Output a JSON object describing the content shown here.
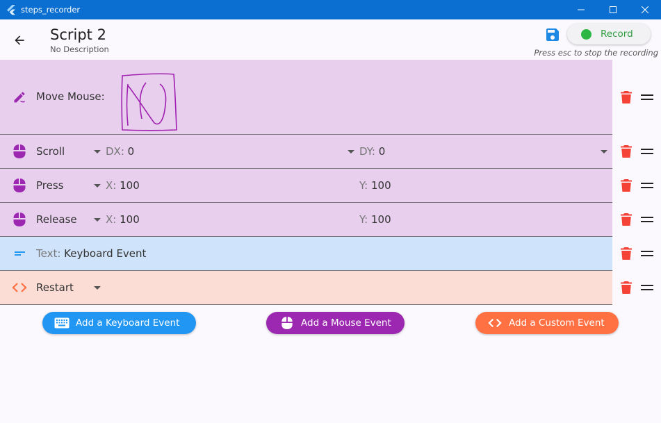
{
  "window": {
    "title": "steps_recorder"
  },
  "header": {
    "title": "Script 2",
    "subtitle": "No Description",
    "record_label": "Record",
    "esc_hint": "Press esc to stop the recording"
  },
  "rows": [
    {
      "type": "mouse",
      "label": "Move Mouse:"
    },
    {
      "type": "mouse",
      "label": "Scroll",
      "x_key": "DX: ",
      "x_val": "0",
      "y_key": "DY: ",
      "y_val": "0"
    },
    {
      "type": "mouse",
      "label": "Press",
      "x_key": "X: ",
      "x_val": "100",
      "y_key": "Y: ",
      "y_val": "100"
    },
    {
      "type": "mouse",
      "label": "Release",
      "x_key": "X: ",
      "x_val": "100",
      "y_key": "Y: ",
      "y_val": "100"
    },
    {
      "type": "keyboard",
      "key": "Text: ",
      "value": "Keyboard Event"
    },
    {
      "type": "custom",
      "label": "Restart"
    }
  ],
  "add_buttons": {
    "keyboard": "Add a Keyboard Event",
    "mouse": "Add a Mouse Event",
    "custom": "Add a Custom Event"
  },
  "icons": {
    "app": "flutter-logo-icon",
    "back": "arrow-left-icon",
    "save": "floppy-disk-icon",
    "move": "draw-pen-icon",
    "mouse": "mouse-icon",
    "text": "short-text-icon",
    "code": "code-brackets-icon",
    "delete": "trash-icon",
    "reorder": "drag-handle-icon",
    "keyboard": "keyboard-icon"
  },
  "colors": {
    "titlebar": "#0a6fd0",
    "mouse_row": "#e8cfee",
    "keyboard_row": "#cfe3fa",
    "custom_row": "#fbddd6",
    "mouse_accent": "#9c27b0",
    "keyboard_accent": "#2196f3",
    "custom_accent": "#ff7043",
    "delete": "#f44336",
    "record": "#2cb745"
  }
}
